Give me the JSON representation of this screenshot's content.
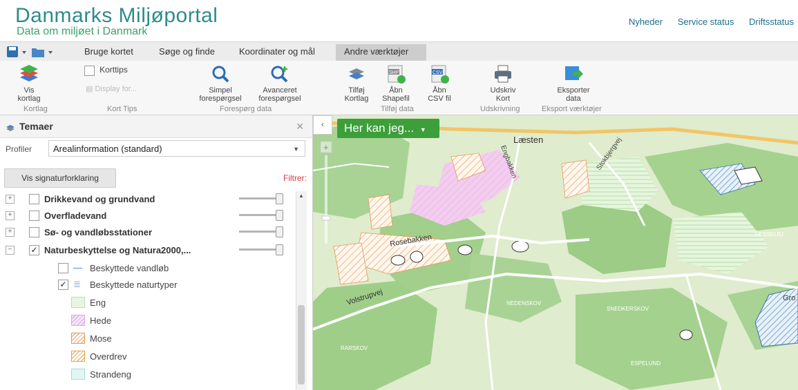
{
  "header": {
    "title": "Danmarks Miljøportal",
    "subtitle": "Data om miljøet i Danmark",
    "links": [
      "Nyheder",
      "Service status",
      "Driftsstatus"
    ]
  },
  "menu": {
    "items": [
      "Bruge kortet",
      "Søge og finde",
      "Koordinater og mål",
      "Andre værktøjer"
    ],
    "active": "Andre værktøjer"
  },
  "ribbon": {
    "vis_kortlag": "Vis kortlag",
    "korttips": "Korttips",
    "display_for": "Display for...",
    "simpel": "Simpel forespørgsel",
    "avanceret": "Avanceret forespørgsel",
    "tilfoej_kortlag": "Tilføj Kortlag",
    "aabn_shapefil": "Åbn Shapefil",
    "aabn_csv": "Åbn CSV fil",
    "udskriv_kort": "Udskriv Kort",
    "eksporter_data": "Eksporter data",
    "groups": [
      "Kortlag",
      "Kort Tips",
      "Forespørg data",
      "Tilføj data",
      "Udskrivning",
      "Eksport værktøjer"
    ]
  },
  "sidebar": {
    "title": "Temaer",
    "profil_label": "Profiler",
    "profil_value": "Arealinformation (standard)",
    "legend_button": "Vis signaturforklaring",
    "filter": "Filtrer:",
    "layers": [
      {
        "name": "Drikkevand og grundvand",
        "expanded": false,
        "checked": false
      },
      {
        "name": "Overfladevand",
        "expanded": false,
        "checked": false
      },
      {
        "name": "Sø- og vandløbsstationer",
        "expanded": false,
        "checked": false
      },
      {
        "name": "Naturbeskyttelse og Natura2000,...",
        "expanded": true,
        "checked": true
      }
    ],
    "sublayers": [
      {
        "name": "Beskyttede vandløb",
        "checked": false
      },
      {
        "name": "Beskyttede naturtyper",
        "checked": true
      }
    ],
    "naturtyper": [
      "Eng",
      "Hede",
      "Mose",
      "Overdrev",
      "Strandeng"
    ]
  },
  "map": {
    "button": "Her kan jeg...",
    "labels": [
      "Læsten",
      "Engbakken",
      "Stokbjergvej",
      "Rosebakken",
      "Volstrupvej",
      "NEDENSKOV",
      "SNEDKERSKOV",
      "HESSELBJ",
      "ESPELUND",
      "RARSKOV",
      "Gro"
    ]
  },
  "colors": {
    "brand": "#2e8b8c",
    "brand_sub": "#3aa26b",
    "button_green": "#3d9f3a",
    "filter_red": "#d23b3b"
  }
}
